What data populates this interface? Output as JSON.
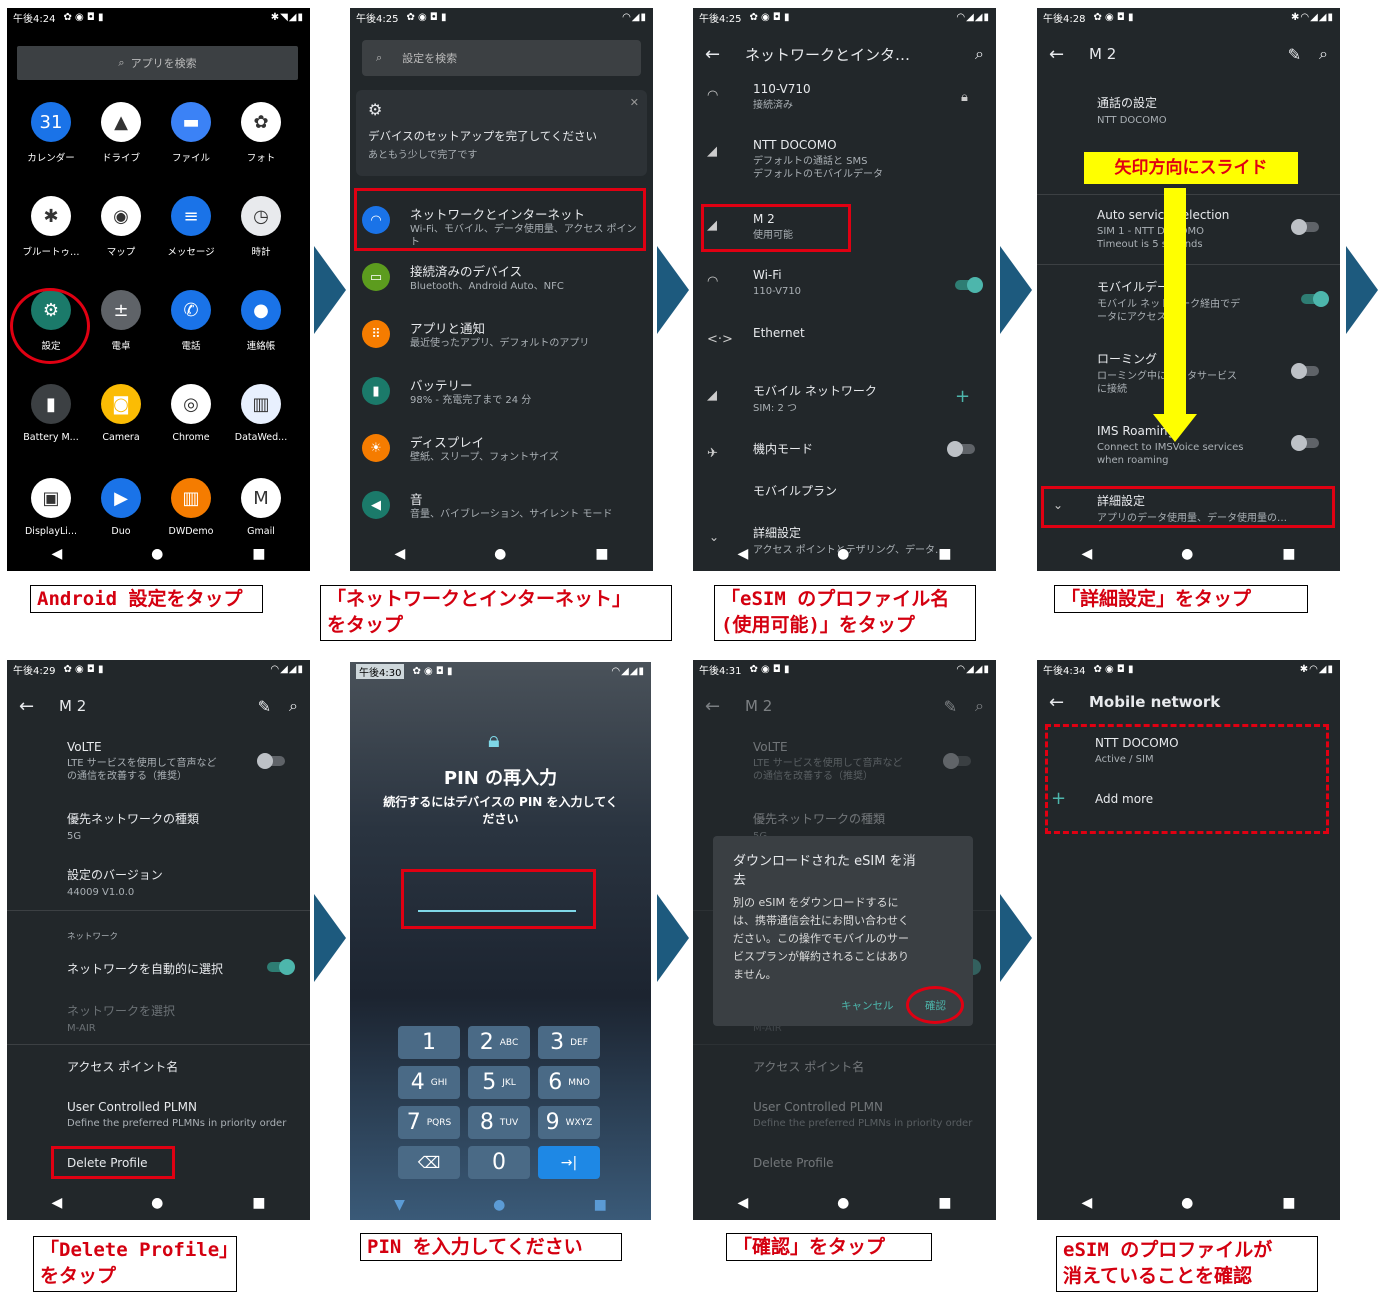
{
  "arrow_icon": "chevron-right-arrow",
  "p1": {
    "status_time": "午後4:24",
    "search_placeholder": "アプリを検索",
    "apps": [
      {
        "label": "カレンダー",
        "color": "#1a73e8",
        "glyph": "31"
      },
      {
        "label": "ドライブ",
        "color": "#ffffff",
        "glyph": "▲"
      },
      {
        "label": "ファイル",
        "color": "#3b82f6",
        "glyph": "▬"
      },
      {
        "label": "フォト",
        "color": "#ffffff",
        "glyph": "✿"
      },
      {
        "label": "ブルートゥ…",
        "color": "#ffffff",
        "glyph": "✱"
      },
      {
        "label": "マップ",
        "color": "#ffffff",
        "glyph": "◉"
      },
      {
        "label": "メッセージ",
        "color": "#1a73e8",
        "glyph": "≡"
      },
      {
        "label": "時計",
        "color": "#e8eaed",
        "glyph": "◷"
      },
      {
        "label": "設定",
        "color": "#1b7a6a",
        "glyph": "⚙"
      },
      {
        "label": "電卓",
        "color": "#5f6368",
        "glyph": "±"
      },
      {
        "label": "電話",
        "color": "#1a73e8",
        "glyph": "✆"
      },
      {
        "label": "連絡帳",
        "color": "#1a73e8",
        "glyph": "●"
      },
      {
        "label": "Battery M...",
        "color": "#3c4043",
        "glyph": "▮"
      },
      {
        "label": "Camera",
        "color": "#fbbc04",
        "glyph": "◙"
      },
      {
        "label": "Chrome",
        "color": "#ffffff",
        "glyph": "◎"
      },
      {
        "label": "DataWed...",
        "color": "#e8f0fe",
        "glyph": "▥"
      },
      {
        "label": "DisplayLi...",
        "color": "#ffffff",
        "glyph": "▣"
      },
      {
        "label": "Duo",
        "color": "#1a73e8",
        "glyph": "▶"
      },
      {
        "label": "DWDemo",
        "color": "#f57c00",
        "glyph": "▥"
      },
      {
        "label": "Gmail",
        "color": "#ffffff",
        "glyph": "M"
      }
    ],
    "caption": "Android 設定をタップ"
  },
  "p2": {
    "status_time": "午後4:25",
    "search_placeholder": "設定を検索",
    "setup_title": "デバイスのセットアップを完了してください",
    "setup_sub": "あともう少しで完了です",
    "items": [
      {
        "title": "ネットワークとインターネット",
        "sub": "Wi-Fi、モバイル、データ使用量、アクセス ポイント",
        "color": "#1a73e8",
        "glyph": "◠"
      },
      {
        "title": "接続済みのデバイス",
        "sub": "Bluetooth、Android Auto、NFC",
        "color": "#5c9c1e",
        "glyph": "▭"
      },
      {
        "title": "アプリと通知",
        "sub": "最近使ったアプリ、デフォルトのアプリ",
        "color": "#f57c00",
        "glyph": "⠿"
      },
      {
        "title": "バッテリー",
        "sub": "98% - 充電完了まで 24 分",
        "color": "#1b7a6a",
        "glyph": "▮"
      },
      {
        "title": "ディスプレイ",
        "sub": "壁紙、スリープ、フォントサイズ",
        "color": "#f57c00",
        "glyph": "☀"
      },
      {
        "title": "音",
        "sub": "音量、バイブレーション、サイレント モード",
        "color": "#1b7a6a",
        "glyph": "◀"
      }
    ],
    "caption_line1": "「ネットワークとインターネット」",
    "caption_line2": "をタップ"
  },
  "p3": {
    "status_time": "午後4:25",
    "title": "ネットワークとインタ…",
    "rows": [
      {
        "title": "110-V710",
        "sub": "接続済み"
      },
      {
        "title": "NTT DOCOMO",
        "sub": "デフォルトの通話と SMS\nデフォルトのモバイルデータ"
      },
      {
        "title": "M 2",
        "sub": "使用可能"
      },
      {
        "title": "Wi-Fi",
        "sub": "110-V710"
      },
      {
        "title": "Ethernet",
        "sub": ""
      },
      {
        "title": "モバイル ネットワーク",
        "sub": "SIM: 2 つ"
      },
      {
        "title": "機内モード",
        "sub": ""
      },
      {
        "title": "モバイルプラン",
        "sub": ""
      },
      {
        "title": "詳細設定",
        "sub": "アクセス ポイントとテザリング、データ…"
      }
    ],
    "caption_line1": "「eSIM のプロファイル名",
    "caption_line2": "(使用可能)」をタップ"
  },
  "p4": {
    "status_time": "午後4:28",
    "title": "M 2",
    "rows": [
      {
        "title": "通話の設定",
        "sub": "NTT DOCOMO"
      },
      {
        "title": "Auto service selection",
        "sub": "SIM 1 - NTT DOCOMO\nTimeout is 5 seconds"
      },
      {
        "title": "モバイルデータ",
        "sub": "モバイル ネットワーク経由でデ\nータにアクセス"
      },
      {
        "title": "ローミング",
        "sub": "ローミング中にデータサービス\nに接続"
      },
      {
        "title": "IMS Roaming",
        "sub": "Connect to IMSVoice services\nwhen roaming"
      },
      {
        "title": "詳細設定",
        "sub": "アプリのデータ使用量、データ使用量の…"
      }
    ],
    "slide_label": "矢印方向にスライド",
    "caption": "「詳細設定」をタップ"
  },
  "p5": {
    "status_time": "午後4:29",
    "title": "M 2",
    "rows": [
      {
        "title": "VoLTE",
        "sub": "LTE サービスを使用して音声など\nの通信を改善する（推奨）"
      },
      {
        "title": "優先ネットワークの種類",
        "sub": "5G"
      },
      {
        "title": "設定のバージョン",
        "sub": "44009 V1.0.0"
      },
      {
        "title": "ネットワーク",
        "sub": ""
      },
      {
        "title": "ネットワークを自動的に選択",
        "sub": ""
      },
      {
        "title": "ネットワークを選択",
        "sub": "M-AIR"
      },
      {
        "title": "アクセス ポイント名",
        "sub": ""
      },
      {
        "title": "User Controlled PLMN",
        "sub": "Define the preferred PLMNs in priority order"
      },
      {
        "title": "Delete Profile",
        "sub": ""
      }
    ],
    "caption_line1": "「Delete Profile」",
    "caption_line2": "をタップ"
  },
  "p6": {
    "status_time": "午後4:30",
    "title": "PIN の再入力",
    "sub": "続行するにはデバイスの PIN を入力してく\nださい",
    "keys": [
      {
        "n": "1",
        "l": ""
      },
      {
        "n": "2",
        "l": "ABC"
      },
      {
        "n": "3",
        "l": "DEF"
      },
      {
        "n": "4",
        "l": "GHI"
      },
      {
        "n": "5",
        "l": "JKL"
      },
      {
        "n": "6",
        "l": "MNO"
      },
      {
        "n": "7",
        "l": "PQRS"
      },
      {
        "n": "8",
        "l": "TUV"
      },
      {
        "n": "9",
        "l": "WXYZ"
      },
      {
        "n": "⌫",
        "l": ""
      },
      {
        "n": "0",
        "l": ""
      },
      {
        "n": "→|",
        "l": ""
      }
    ],
    "caption": "PIN を入力してください"
  },
  "p7": {
    "status_time": "午後4:31",
    "title": "M 2",
    "dialog_title": "ダウンロードされた eSIM を消\n去",
    "dialog_body": "別の eSIM をダウンロードするに\nは、携帯通信会社にお問い合わせく\nださい。この操作でモバイルのサー\nビスプランが解約されることはあり\nません。",
    "cancel": "キャンセル",
    "confirm": "確認",
    "caption": "「確認」をタップ"
  },
  "p8": {
    "status_time": "午後4:34",
    "title": "Mobile network",
    "carrier": "NTT DOCOMO",
    "carrier_sub": "Active / SIM",
    "add_more": "Add more",
    "caption_line1": "eSIM のプロファイルが",
    "caption_line2": "消えていることを確認"
  }
}
